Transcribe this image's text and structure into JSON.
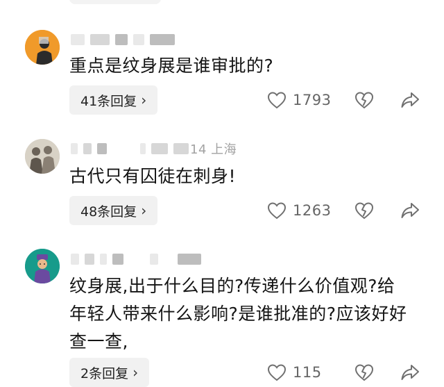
{
  "comments": [
    {
      "id": "c1",
      "content": "重点是纹身展是谁审批的?",
      "meta_text": "",
      "reply_label": "41条回复",
      "like_count": "1793"
    },
    {
      "id": "c2",
      "content": "古代只有囚徒在刺身!",
      "meta_text": "14 上海",
      "reply_label": "48条回复",
      "like_count": "1263"
    },
    {
      "id": "c3",
      "content": "纹身展,出于什么目的?传递什么价值观?给年轻人带来什么影响?是谁批准的?应该好好查一查,",
      "meta_text": "",
      "reply_label": "2条回复",
      "like_count": "115"
    }
  ],
  "icons": {
    "like": "heart-outline-icon",
    "dislike": "broken-heart-icon",
    "share": "share-arrow-icon",
    "chevron": "chevron-right-icon"
  },
  "chevron_glyph": "›",
  "colors": {
    "text": "#141414",
    "muted": "#a2a2a2",
    "pill_bg": "#f1f1f1",
    "icon": "#707070"
  }
}
